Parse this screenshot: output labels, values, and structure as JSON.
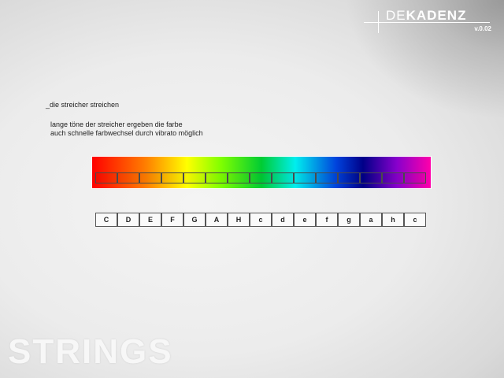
{
  "logo": {
    "title_light": "DE",
    "title_bold": "KADENZ",
    "version": "v.0.02"
  },
  "section": {
    "heading": "_die streicher streichen",
    "description_lines": [
      "lange töne der streicher ergeben die farbe",
      "auch schnelle farbwechsel durch vibrato möglich"
    ]
  },
  "notes": [
    "C",
    "D",
    "E",
    "F",
    "G",
    "A",
    "H",
    "c",
    "d",
    "e",
    "f",
    "g",
    "a",
    "h",
    "c"
  ],
  "instrument_label": "STRINGS"
}
